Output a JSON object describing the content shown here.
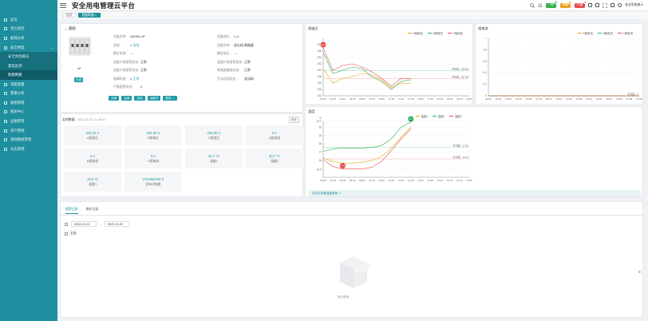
{
  "app": {
    "title": "安全用电管理云平台"
  },
  "header": {
    "buttons": [
      {
        "label": "一般",
        "color": "#33b04c",
        "count": "0"
      },
      {
        "label": "预警",
        "color": "#f0a020",
        "count": "0"
      },
      {
        "label": "严重",
        "color": "#e84a4a",
        "count": "0"
      }
    ],
    "user_name": "安全用电演示"
  },
  "sidebar": {
    "items": [
      {
        "label": "首页",
        "arrow": ""
      },
      {
        "label": "电力监控",
        "arrow": "›"
      },
      {
        "label": "能耗分析",
        "arrow": "›"
      },
      {
        "label": "安全用电",
        "arrow": "⌄"
      }
    ],
    "submenu": [
      {
        "label": "安全用电概览",
        "active": false
      },
      {
        "label": "漏电监测",
        "active": false
      },
      {
        "label": "智能断路",
        "active": true
      }
    ],
    "items_after": [
      {
        "label": "电能质量",
        "arrow": "›"
      },
      {
        "label": "需量分析",
        "arrow": "›"
      },
      {
        "label": "报警管理",
        "arrow": "›"
      },
      {
        "label": "报表中心",
        "arrow": "›"
      },
      {
        "label": "运维管理",
        "arrow": "›"
      },
      {
        "label": "用户管理",
        "arrow": "›"
      },
      {
        "label": "基础数据管理",
        "arrow": "›"
      },
      {
        "label": "日志管理",
        "arrow": "›"
      }
    ]
  },
  "tabs": [
    {
      "label": "首页",
      "active": false
    },
    {
      "label": "智能断路 ×",
      "active": true
    }
  ],
  "device": {
    "section_title": "基础",
    "type_label": "4P",
    "status_badge": "在线",
    "fields": [
      [
        {
          "label": "设备名称:",
          "value": "ASCB1-4P"
        },
        {
          "label": "设备地址:",
          "value": "1_0"
        }
      ],
      [
        {
          "label": "状态:",
          "value": "● 合闸"
        },
        {
          "label": "回路名称:",
          "value": "进出线-断路器"
        }
      ],
      [
        {
          "label": "额定电流:",
          "value": "—"
        },
        {
          "label": "额定电压:",
          "value": "—"
        }
      ],
      [
        {
          "label": "温度升高报警状态:",
          "value": "正常"
        },
        {
          "label": "温度升高报警状态:",
          "value": "正常"
        }
      ],
      [
        {
          "label": "温度升高报警状态:",
          "value": "正常"
        },
        {
          "label": "断路器漏电状态:",
          "value": "正常"
        }
      ],
      [
        {
          "label": "故障状态:",
          "value": "● 正常"
        },
        {
          "label": "手动远程状态:",
          "value": "关闭阀"
        }
      ],
      [
        {
          "label": "严重报警状态:",
          "value": "0"
        },
        {
          "label": "",
          "value": ""
        }
      ]
    ],
    "actions": [
      "分闸",
      "合闸",
      "自检",
      "远程开",
      "更多 ⌄"
    ]
  },
  "realtime": {
    "title": "实时数据",
    "timestamp": "2022-01-02 11:48:00",
    "more": "历史",
    "cells": [
      {
        "value": "225.10 V",
        "name": "A相电压"
      },
      {
        "value": "234.50 V",
        "name": "B相电压"
      },
      {
        "value": "235.30 V",
        "name": "C相电压"
      },
      {
        "value": "0 A",
        "name": "A相电流"
      },
      {
        "value": "0 A",
        "name": "B相电流"
      },
      {
        "value": "0 A",
        "name": "C相电流"
      },
      {
        "value": "20.7 ℃",
        "name": "温度1"
      },
      {
        "value": "20.7 ℃",
        "name": "温度2"
      },
      {
        "value": "19.0 ℃",
        "name": "温度3"
      },
      {
        "value": "270.850 kW·h",
        "name": "总有功电能"
      }
    ]
  },
  "bottom": {
    "tabs": [
      "报警记录",
      "操作记录"
    ],
    "date_start": "2022-01-01",
    "date_sep": "-",
    "date_end": "2022-01-02",
    "checkbox_label": "全选",
    "empty_text": "暂无数据"
  },
  "chart_data": [
    {
      "type": "line",
      "title": "相电压",
      "x": [
        "00:00",
        "01:35",
        "03:10",
        "04:45",
        "06:20",
        "07:55",
        "09:30",
        "11:05",
        "12:40",
        "14:15",
        "15:50",
        "17:25",
        "19:00",
        "20:35",
        "22:10",
        "23:55"
      ],
      "ylim": [
        222,
        240
      ],
      "yticks": [
        222,
        224,
        226,
        228,
        230,
        232,
        234,
        236,
        238
      ],
      "series": [
        {
          "name": "A相电压",
          "color": "#e8a317",
          "values": [
            230.5,
            226.0,
            227.5,
            228.0,
            229.0,
            228.5,
            227.0,
            224.5,
            226.0,
            225.8,
            null,
            null,
            null,
            null,
            null,
            null
          ]
        },
        {
          "name": "B相电压",
          "color": "#2eaa4f",
          "values": [
            235.5,
            229.0,
            230.0,
            231.0,
            230.5,
            228.0,
            226.5,
            224.0,
            226.5,
            227.0,
            null,
            null,
            null,
            null,
            null,
            null
          ]
        },
        {
          "name": "C相电压",
          "color": "#e84a4a",
          "values": [
            237.0,
            230.0,
            231.5,
            232.0,
            231.0,
            229.5,
            227.5,
            225.0,
            227.5,
            227.3,
            null,
            null,
            null,
            null,
            null,
            null
          ]
        }
      ],
      "markers": [
        {
          "label": "237.3",
          "series": 2,
          "index": 0
        }
      ],
      "avg_lines": [
        {
          "text": "平均值：229.89",
          "y": 229.9,
          "color": "#2eaa4f"
        },
        {
          "text": "平均值：227.39",
          "y": 227.4,
          "color": "#e84a4a"
        }
      ]
    },
    {
      "type": "line",
      "title": "相电流",
      "x": [
        "00:00",
        "01:32",
        "03:04",
        "04:36",
        "06:08",
        "07:40",
        "09:12",
        "10:44",
        "12:16",
        "13:48",
        "15:20",
        "16:52",
        "18:24",
        "19:56",
        "21:28",
        "23:55"
      ],
      "ylim": [
        0,
        1
      ],
      "yticks": [
        0,
        0.2,
        0.4,
        0.6,
        0.8,
        1
      ],
      "series": [
        {
          "name": "A相电流",
          "color": "#e8a317",
          "values": [
            0
          ]
        },
        {
          "name": "B相电流",
          "color": "#2eaa4f",
          "values": [
            0
          ]
        },
        {
          "name": "C相电流",
          "color": "#e84a4a",
          "values": [
            0
          ]
        }
      ],
      "avg_lines": [
        {
          "text": "平均值：0",
          "y": 0,
          "color": "#2eaa4f"
        }
      ]
    },
    {
      "type": "line",
      "title": "温度",
      "unit": "℃",
      "x": [
        "00:00",
        "01:30",
        "03:00",
        "04:30",
        "06:00",
        "07:30",
        "09:00",
        "10:30",
        "12:00",
        "13:30",
        "15:00",
        "16:30",
        "18:00",
        "19:30",
        "21:00",
        "23:55"
      ],
      "ylim": [
        14,
        20.7
      ],
      "yticks": [
        14.9,
        16,
        17,
        18,
        19,
        20,
        20.7
      ],
      "series": [
        {
          "name": "温度1",
          "color": "#e8a317",
          "values": [
            16.3,
            15.9,
            15.7,
            15.7,
            15.8,
            16.0,
            16.5,
            17.5,
            18.8,
            20.0,
            null,
            null,
            null,
            null,
            null,
            null
          ]
        },
        {
          "name": "温度2",
          "color": "#2eaa4f",
          "values": [
            17.1,
            17.4,
            17.5,
            17.5,
            17.5,
            17.6,
            17.8,
            18.6,
            20.0,
            20.6,
            null,
            null,
            null,
            null,
            null,
            null
          ]
        },
        {
          "name": "温度3",
          "color": "#e84a4a",
          "values": [
            16.1,
            15.3,
            15.0,
            15.0,
            15.0,
            15.2,
            15.9,
            17.2,
            18.6,
            19.8,
            null,
            null,
            null,
            null,
            null,
            null
          ]
        }
      ],
      "markers": [
        {
          "label": "14.9",
          "series": 2,
          "index": 2
        },
        {
          "label": "20.7",
          "series": 1,
          "index": 9
        }
      ],
      "avg_lines": [
        {
          "text": "平均值：17.61",
          "y": 17.6,
          "color": "#2eaa4f"
        },
        {
          "text": "平均值：16.23",
          "y": 16.2,
          "color": "#e84a4a"
        }
      ],
      "footer_note": "未过应设备温度参数 ⓘ"
    }
  ]
}
